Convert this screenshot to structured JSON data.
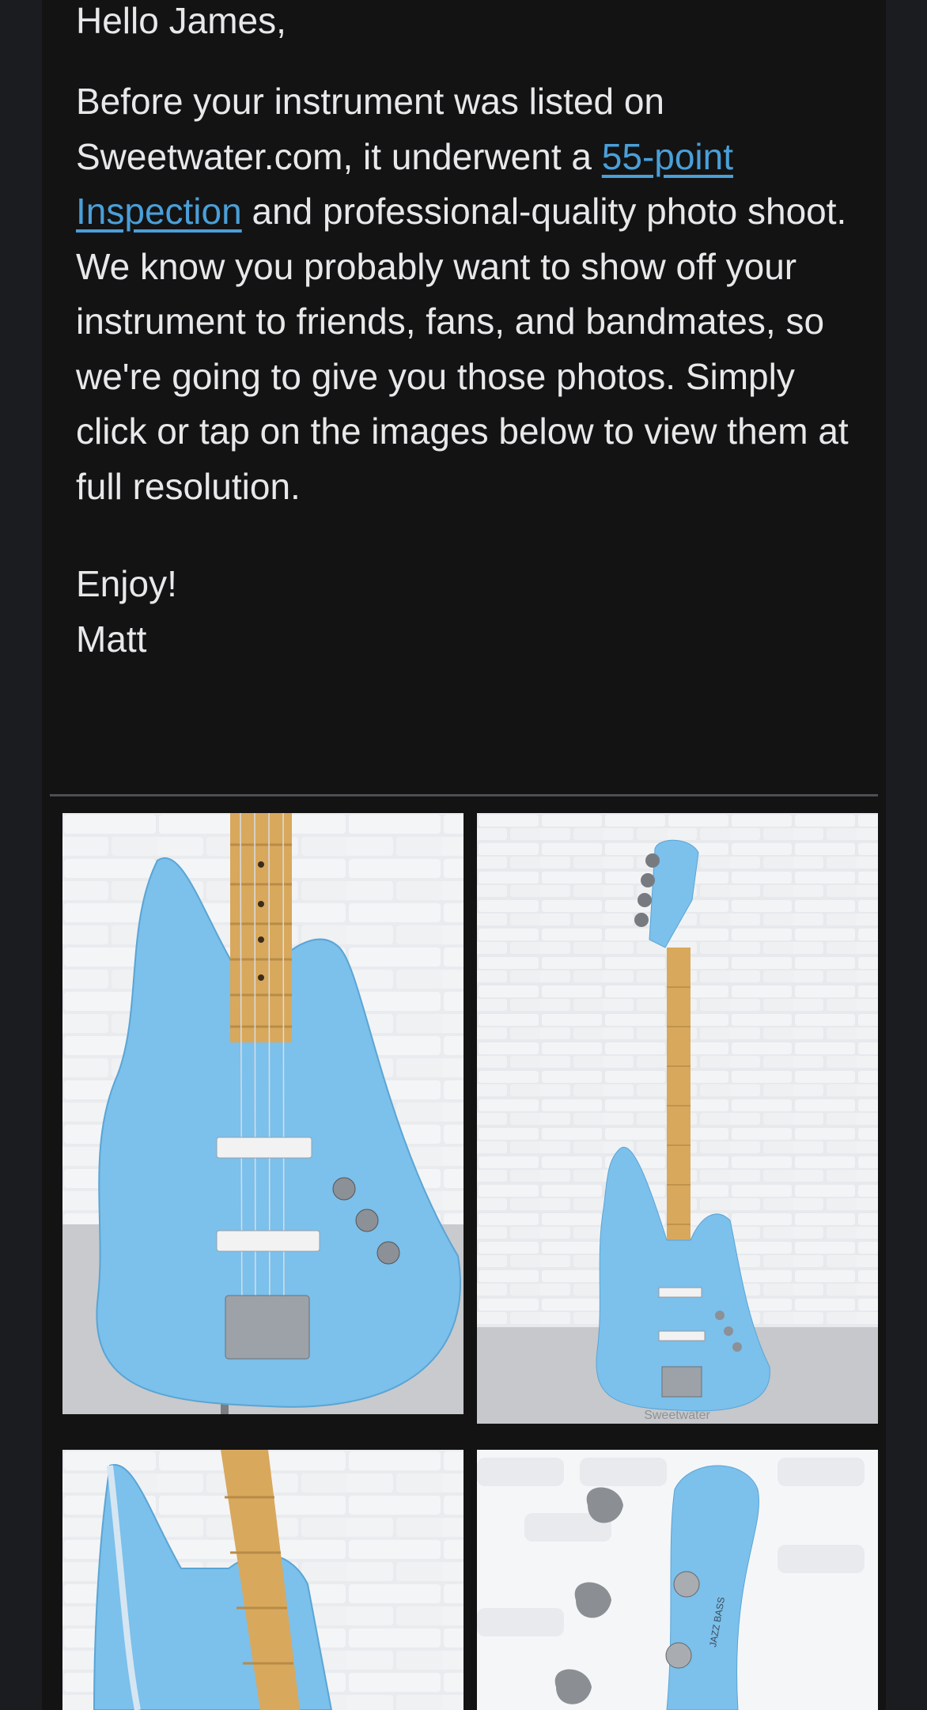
{
  "email": {
    "greeting": "Hello James,",
    "body_before_link": "Before your instrument was listed on Sweetwater.com, it underwent a ",
    "link_text": "55-point Inspection",
    "body_after_link": " and professional-quality photo shoot. We know you probably want to show off your instrument to friends, fans, and bandmates, so we're going to give you those photos. Simply click or tap on the images below to view them at full resolution.",
    "closing": "Enjoy!",
    "signature": "Matt"
  },
  "photos": [
    {
      "label": "Bass body close-up"
    },
    {
      "label": "Full bass front view",
      "watermark": "Sweetwater"
    },
    {
      "label": "Bass body angled side view"
    },
    {
      "label": "Bass headstock close-up",
      "headstock_text": "JAZZ BASS"
    }
  ],
  "colors": {
    "guitar_blue": "#7cc0ec",
    "link": "#4a9fd8",
    "background": "#131314"
  }
}
